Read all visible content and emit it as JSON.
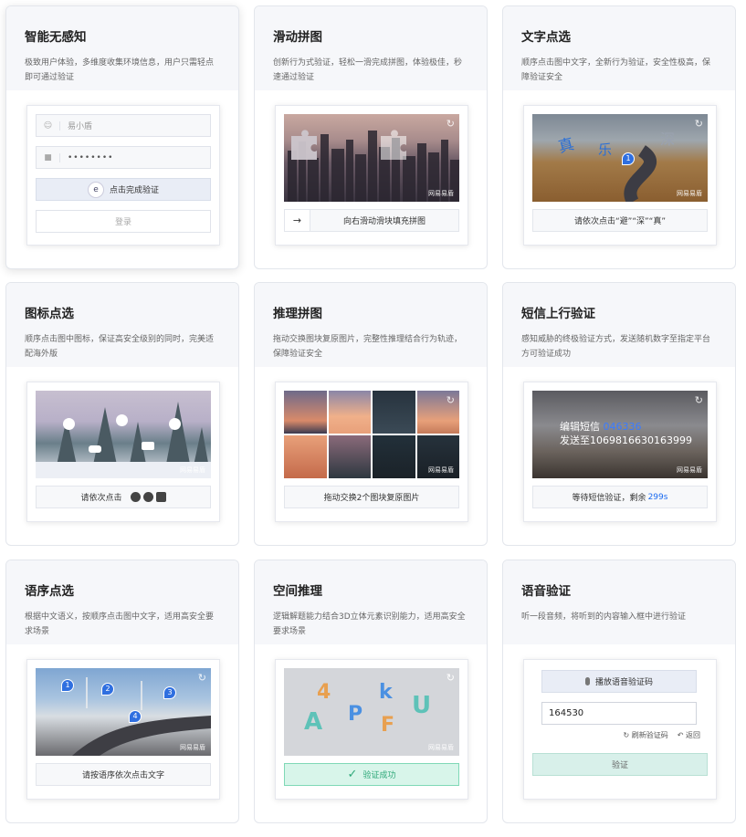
{
  "cards": [
    {
      "title": "智能无感知",
      "desc": "极致用户体验，多维度收集环境信息，用户只需轻点即可通过验证",
      "form": {
        "username": "易小盾",
        "password": "••••••••",
        "verify_btn": "点击完成验证",
        "login_btn": "登录"
      }
    },
    {
      "title": "滑动拼图",
      "desc": "创新行为式验证，轻松一滑完成拼图，体验极佳，秒速通过验证",
      "bar": "向右滑动滑块填充拼图",
      "arrow": "→"
    },
    {
      "title": "文字点选",
      "desc": "顺序点击图中文字，全新行为验证，安全性极高，保障验证安全",
      "bar": "请依次点击“避”“深”“真”",
      "chars": [
        "真",
        "乐",
        "深"
      ],
      "pin": "1"
    },
    {
      "title": "图标点选",
      "desc": "顺序点击图中图标，保证高安全级别的同时，完美适配海外版",
      "bar": "请依次点击"
    },
    {
      "title": "推理拼图",
      "desc": "拖动交换图块复原图片，完整性推理结合行为轨迹，保障验证安全",
      "bar": "拖动交换2个图块复原图片"
    },
    {
      "title": "短信上行验证",
      "desc": "感知威胁的终极验证方式，发送随机数字至指定平台方可验证成功",
      "sms_line1": "编辑短信",
      "sms_code": "046336",
      "sms_line2": "发送至1069816630163999",
      "bar_prefix": "等待短信验证，剩余",
      "bar_time": "299s"
    },
    {
      "title": "语序点选",
      "desc": "根据中文语义，按顺序点击图中文字，适用高安全要求场景",
      "bar": "请按语序依次点击文字",
      "pins": [
        "1",
        "2",
        "3",
        "4"
      ]
    },
    {
      "title": "空间推理",
      "desc": "逻辑解题能力结合3D立体元素识别能力，适用高安全要求场景",
      "success": "验证成功",
      "letters": [
        "4",
        "A",
        "P",
        "k",
        "F",
        "U"
      ]
    },
    {
      "title": "语音验证",
      "desc": "听一段音频，将听到的内容输入框中进行验证",
      "audio_btn": "播放语音验证码",
      "code": "164530",
      "refresh": "刷新验证码",
      "back": "返回",
      "verify": "验证"
    }
  ],
  "watermark": "网易易盾",
  "icons": {
    "refresh": "↻",
    "user": "user-icon",
    "lock": "lock-icon",
    "mic": "mic-icon",
    "check": "✓"
  }
}
